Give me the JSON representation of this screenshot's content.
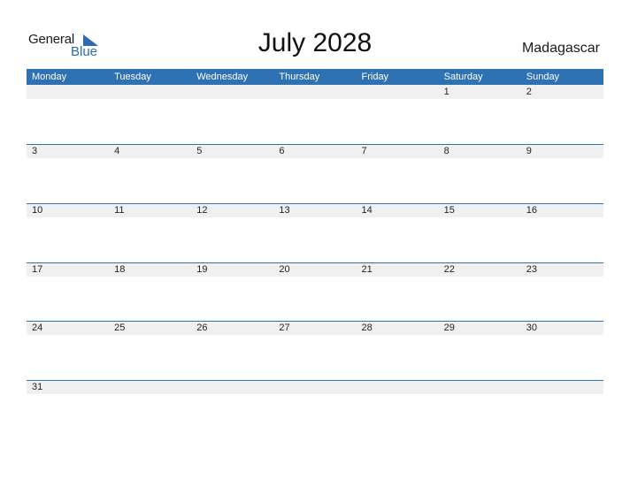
{
  "logo": {
    "general": "General",
    "blue": "Blue",
    "icon": "triangle-flag-icon",
    "accent": "#2b6cb0"
  },
  "title": "July 2028",
  "country": "Madagascar",
  "colors": {
    "header": "#2e72b4",
    "band": "#f0f0f0"
  },
  "weekdays": [
    "Monday",
    "Tuesday",
    "Wednesday",
    "Thursday",
    "Friday",
    "Saturday",
    "Sunday"
  ],
  "weeks": [
    [
      "",
      "",
      "",
      "",
      "",
      "1",
      "2"
    ],
    [
      "3",
      "4",
      "5",
      "6",
      "7",
      "8",
      "9"
    ],
    [
      "10",
      "11",
      "12",
      "13",
      "14",
      "15",
      "16"
    ],
    [
      "17",
      "18",
      "19",
      "20",
      "21",
      "22",
      "23"
    ],
    [
      "24",
      "25",
      "26",
      "27",
      "28",
      "29",
      "30"
    ],
    [
      "31",
      "",
      "",
      "",
      "",
      "",
      ""
    ]
  ]
}
